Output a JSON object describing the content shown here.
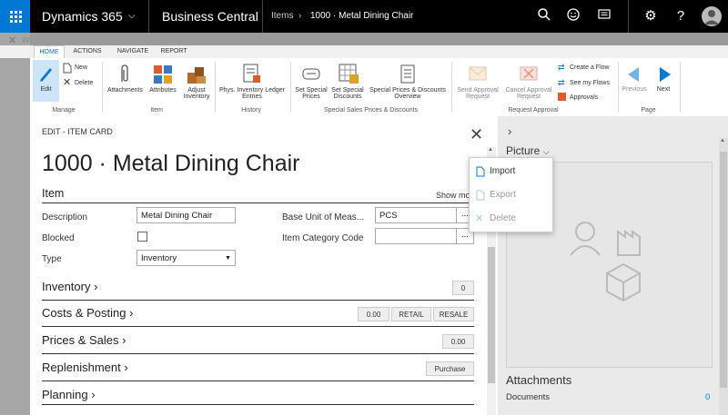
{
  "topbar": {
    "product": "Dynamics 365",
    "app": "Business Central",
    "breadcrumb": [
      "Items",
      "1000 · Metal Dining Chair"
    ],
    "accent": "#0078d4"
  },
  "ribbon": {
    "tabs": [
      "HOME",
      "ACTIONS",
      "NAVIGATE",
      "REPORT"
    ],
    "active_tab": "HOME",
    "buttons": {
      "edit": "Edit",
      "new": "New",
      "delete": "Delete",
      "attachments": "Attachments",
      "attributes": "Attributes",
      "adjust_inventory_1": "Adjust",
      "adjust_inventory_2": "Inventory",
      "phys_inv_1": "Phys. Inventory Ledger",
      "phys_inv_2": "Entries",
      "set_special_prices_1": "Set Special",
      "set_special_prices_2": "Prices",
      "set_special_discounts_1": "Set Special",
      "set_special_discounts_2": "Discounts",
      "special_overview_1": "Special Prices & Discounts",
      "special_overview_2": "Overview",
      "send_approval_1": "Send Approval",
      "send_approval_2": "Request",
      "cancel_approval_1": "Cancel Approval",
      "cancel_approval_2": "Request",
      "create_flow": "Create a Flow",
      "see_flows": "See my Flows",
      "approvals": "Approvals",
      "previous": "Previous",
      "next": "Next"
    },
    "groups": {
      "manage": "Manage",
      "item": "Item",
      "history": "History",
      "special": "Special Sales Prices & Discounts",
      "request_approval": "Request Approval",
      "page": "Page"
    }
  },
  "card": {
    "mode_label": "EDIT - ITEM CARD",
    "title": "1000 · Metal Dining Chair",
    "item_section": "Item",
    "show_more": "Show more",
    "fields": {
      "description_label": "Description",
      "description_value": "Metal Dining Chair",
      "blocked_label": "Blocked",
      "type_label": "Type",
      "type_value": "Inventory",
      "base_uom_label": "Base Unit of Meas...",
      "base_uom_value": "PCS",
      "item_category_label": "Item Category Code",
      "item_category_value": ""
    },
    "fasttabs": {
      "inventory": "Inventory",
      "inventory_cue": "0",
      "costs": "Costs & Posting",
      "costs_cues": [
        "0.00",
        "RETAIL",
        "RESALE"
      ],
      "prices": "Prices & Sales",
      "prices_cue": "0.00",
      "replenishment": "Replenishment",
      "replenishment_cue": "Purchase",
      "planning": "Planning"
    }
  },
  "picture_menu": {
    "import": "Import",
    "export": "Export",
    "delete": "Delete"
  },
  "factbox": {
    "picture": "Picture",
    "attachments": "Attachments",
    "documents": "Documents",
    "documents_count": "0"
  }
}
